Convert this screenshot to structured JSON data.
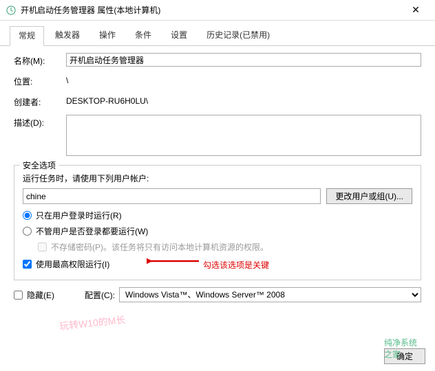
{
  "titlebar": {
    "icon": "clock-icon",
    "title": "开机启动任务管理器 属性(本地计算机)",
    "close": "✕"
  },
  "tabs": [
    {
      "label": "常规",
      "active": true
    },
    {
      "label": "触发器",
      "active": false
    },
    {
      "label": "操作",
      "active": false
    },
    {
      "label": "条件",
      "active": false
    },
    {
      "label": "设置",
      "active": false
    },
    {
      "label": "历史记录(已禁用)",
      "active": false
    }
  ],
  "fields": {
    "name_label": "名称(M):",
    "name_value": "开机启动任务管理器",
    "location_label": "位置:",
    "location_value": "\\",
    "creator_label": "创建者:",
    "creator_value": "DESKTOP-RU6H0LU\\",
    "description_label": "描述(D):",
    "description_value": ""
  },
  "security": {
    "group_title": "安全选项",
    "account_prompt": "运行任务时，请使用下列用户帐户:",
    "account_value": "chine",
    "change_user_btn": "更改用户或组(U)...",
    "radio_logged_on": "只在用户登录时运行(R)",
    "radio_any": "不管用户是否登录都要运行(W)",
    "no_store_pw": "不存储密码(P)。该任务将只有访问本地计算机资源的权限。",
    "highest_priv": "使用最高权限运行(I)",
    "radio_selected": "logged_on",
    "highest_checked": true
  },
  "annotation": {
    "text": "勾选该选项是关键"
  },
  "bottom": {
    "hidden_label": "隐藏(E)",
    "hidden_checked": false,
    "config_label": "配置(C):",
    "config_value": "Windows Vista™、Windows Server™ 2008"
  },
  "footer": {
    "ok": "确定"
  },
  "watermark": "玩转W10的M长",
  "brand": "纯净系统之家"
}
